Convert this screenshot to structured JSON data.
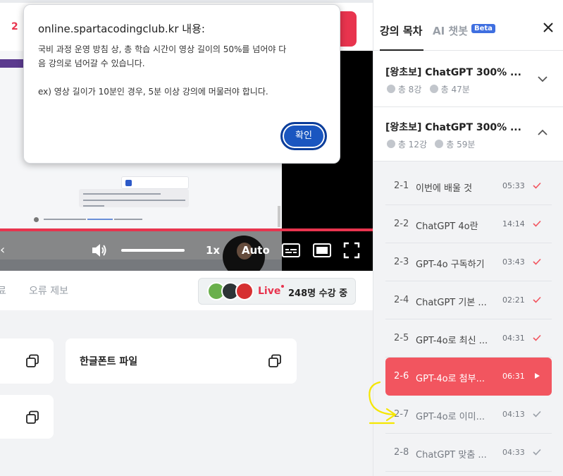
{
  "page": {
    "top_number": "2"
  },
  "video": {
    "speed": "1x",
    "quality": "Auto",
    "progress_fraction": 1.0
  },
  "lecture_tabs": {
    "partial_tab": "료",
    "report_tab": "오류 제보"
  },
  "live": {
    "badge": "Live",
    "count": "248명 수강 중"
  },
  "files": {
    "hangul_font": "한글폰트 파일"
  },
  "sidebar": {
    "tabs": {
      "toc": "강의 목차",
      "ai": "AI 챗봇",
      "beta": "Beta"
    },
    "sections": [
      {
        "title": "[왕초보] ChatGPT 300% ...",
        "lectures": "총 8강",
        "duration": "총 47분",
        "expanded": false
      },
      {
        "title": "[왕초보] ChatGPT 300% ...",
        "lectures": "총 12강",
        "duration": "총 59분",
        "expanded": true
      }
    ],
    "lessons": [
      {
        "num": "2-1",
        "title": "이번에 배울 것",
        "dur": "05:33",
        "state": "done"
      },
      {
        "num": "2-2",
        "title": "ChatGPT 4o란",
        "dur": "14:14",
        "state": "done"
      },
      {
        "num": "2-3",
        "title": "GPT-4o 구독하기",
        "dur": "03:43",
        "state": "done"
      },
      {
        "num": "2-4",
        "title": "ChatGPT 기본 ...",
        "dur": "02:21",
        "state": "done"
      },
      {
        "num": "2-5",
        "title": "GPT-4o로 최신 ...",
        "dur": "04:31",
        "state": "done"
      },
      {
        "num": "2-6",
        "title": "GPT-4o로 첨부...",
        "dur": "06:31",
        "state": "playing"
      },
      {
        "num": "2-7",
        "title": "GPT-4o로 이미...",
        "dur": "04:13",
        "state": "pending"
      },
      {
        "num": "2-8",
        "title": "ChatGPT 맞춤 ...",
        "dur": "04:33",
        "state": "pending"
      }
    ]
  },
  "dialog": {
    "title": "online.spartacodingclub.kr 내용:",
    "body_line1": "국비 과정 운영 방침 상, 총 학습 시간이 영상 길이의 50%를 넘어야 다",
    "body_line2": "음 강의로 넘어갈 수 있습니다.",
    "body_line3": "ex) 영상 길이가 10분인 경우, 5분 이상 강의에 머물러야 합니다.",
    "ok": "확인"
  },
  "colors": {
    "accent": "#e8344e",
    "active_lesson": "#f2555f",
    "dialog_button": "#1a56c0",
    "annotation": "#f5e600"
  }
}
